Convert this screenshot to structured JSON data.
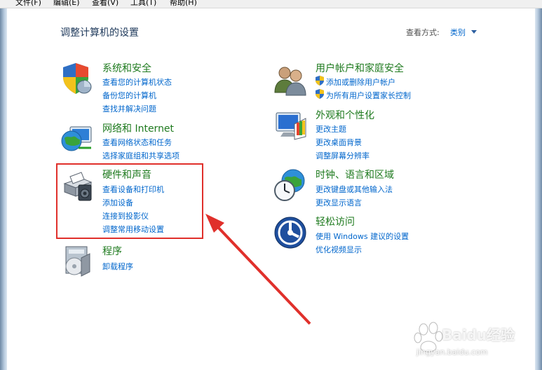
{
  "menu": [
    "文件(F)",
    "编辑(E)",
    "查看(V)",
    "工具(T)",
    "帮助(H)"
  ],
  "header": {
    "title": "调整计算机的设置",
    "view_by_label": "查看方式:",
    "view_by_value": "类别"
  },
  "categories": [
    {
      "title": "系统和安全",
      "icon": "shield-computer-icon",
      "links": [
        "查看您的计算机状态",
        "备份您的计算机",
        "查找并解决问题"
      ]
    },
    {
      "title": "网络和 Internet",
      "icon": "network-globe-icon",
      "links": [
        "查看网络状态和任务",
        "选择家庭组和共享选项"
      ]
    },
    {
      "title": "硬件和声音",
      "icon": "printer-speaker-icon",
      "links": [
        "查看设备和打印机",
        "添加设备",
        "连接到投影仪",
        "调整常用移动设置"
      ]
    },
    {
      "title": "程序",
      "icon": "programs-box-icon",
      "links": [
        "卸载程序"
      ]
    },
    {
      "title": "用户帐户和家庭安全",
      "icon": "users-icon",
      "links": [
        "添加或删除用户帐户",
        "为所有用户设置家长控制"
      ]
    },
    {
      "title": "外观和个性化",
      "icon": "monitor-palette-icon",
      "links": [
        "更改主题",
        "更改桌面背景",
        "调整屏幕分辨率"
      ]
    },
    {
      "title": "时钟、语言和区域",
      "icon": "clock-globe-icon",
      "links": [
        "更改键盘或其他输入法",
        "更改显示语言"
      ]
    },
    {
      "title": "轻松访问",
      "icon": "ease-of-access-icon",
      "links": [
        "使用 Windows 建议的设置",
        "优化视频显示"
      ]
    }
  ],
  "watermark": {
    "logo": "Baidu经验",
    "url": "jingyan.baidu.com"
  },
  "colors": {
    "title_green": "#1e7a1e",
    "link_blue": "#0066cc",
    "highlight_red": "#e0302b"
  }
}
